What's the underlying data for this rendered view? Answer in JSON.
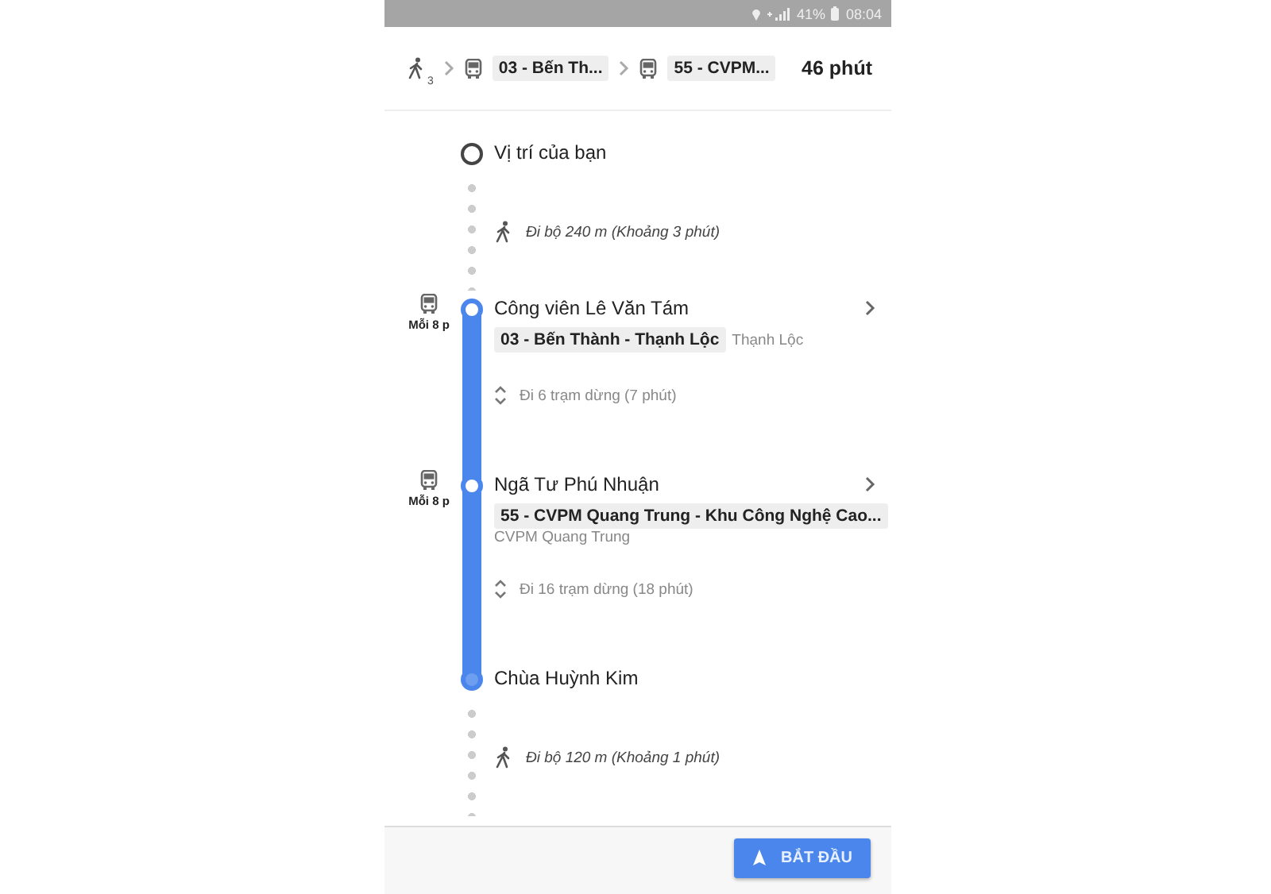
{
  "status_bar": {
    "battery": "41%",
    "time": "08:04"
  },
  "route_summary": {
    "steps": [
      {
        "kind": "walk",
        "minutes": "3"
      },
      {
        "kind": "bus",
        "route": "03 - Bến Th..."
      },
      {
        "kind": "bus",
        "route": "55 - CVPM..."
      }
    ],
    "duration": "46 phút"
  },
  "timeline": [
    {
      "kind": "stop",
      "name": "Vị trí của bạn"
    },
    {
      "kind": "walk",
      "text": "Đi bộ 240 m (Khoảng 3 phút)"
    },
    {
      "kind": "stop",
      "name": "Công viên Lê Văn Tám",
      "frequency": "Mỗi 8 p",
      "route": "03 - Bến Thành - Thạnh Lộc",
      "headsign": "Thạnh Lộc"
    },
    {
      "kind": "ride",
      "text": "Đi 6 trạm dừng (7 phút)"
    },
    {
      "kind": "stop",
      "name": "Ngã Tư Phú Nhuận",
      "frequency": "Mỗi 8 p",
      "route": "55 - CVPM Quang Trung - Khu Công Nghệ Cao...",
      "headsign": "CVPM Quang Trung"
    },
    {
      "kind": "ride",
      "text": "Đi 16 trạm dừng (18 phút)"
    },
    {
      "kind": "stop",
      "name": "Chùa Huỳnh Kim"
    },
    {
      "kind": "walk",
      "text": "Đi bộ 120 m (Khoảng 1 phút)"
    }
  ],
  "start_button": {
    "label": "BẮT ĐẦU"
  }
}
